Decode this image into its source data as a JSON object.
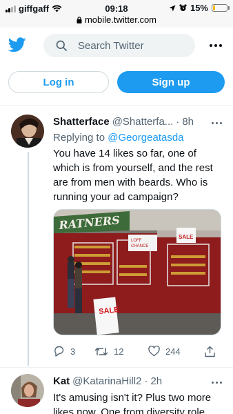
{
  "status_bar": {
    "carrier": "giffgaff",
    "time": "09:18",
    "url": "mobile.twitter.com",
    "battery": "15%",
    "battery_level": 0.15,
    "icons": [
      "signal-icon",
      "wifi-icon",
      "lock-icon",
      "location-icon",
      "alarm-icon",
      "battery-icon"
    ]
  },
  "header": {
    "logo_icon": "twitter-bird-icon",
    "search_placeholder": "Search Twitter",
    "more_icon": "more-icon"
  },
  "auth": {
    "login_label": "Log in",
    "signup_label": "Sign up"
  },
  "colors": {
    "accent": "#1d9bf0",
    "text": "#0f1419",
    "secondary": "#536471"
  },
  "tweets": [
    {
      "name": "Shatterface",
      "handle": "@Shatterfa...",
      "time": "8h",
      "separator": "·",
      "replying_prefix": "Replying to",
      "replying_handle": "@Georgeatasda",
      "text": "You have 14 likes so far, one of which is from yourself, and the rest are from men with beards. Who is running your ad campaign?",
      "media": {
        "shop_sign": "RATNERS",
        "banners": [
          "SALE",
          "SALE"
        ],
        "poster_lines": [
          "LOFF",
          "CHANCE"
        ]
      },
      "actions": {
        "replies": "3",
        "retweets": "12",
        "likes": "244"
      }
    },
    {
      "name": "Kat",
      "handle": "@KatarinaHill2",
      "time": "2h",
      "separator": "·",
      "text": "It's amusing isn't it? Plus two more likes now. One from diversity role"
    }
  ]
}
